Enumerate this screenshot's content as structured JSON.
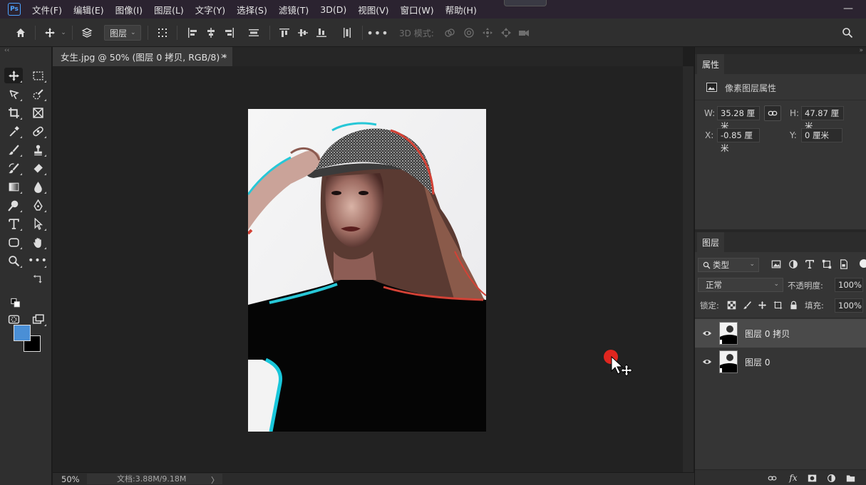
{
  "menubar": {
    "logo": "Ps",
    "items": [
      "文件(F)",
      "编辑(E)",
      "图像(I)",
      "图层(L)",
      "文字(Y)",
      "选择(S)",
      "滤镜(T)",
      "3D(D)",
      "视图(V)",
      "窗口(W)",
      "帮助(H)"
    ],
    "minimize": "—"
  },
  "options": {
    "layer_select": "图层",
    "mode_3d_label": "3D 模式:"
  },
  "toolbar": {
    "collapse": "‹‹",
    "foreground_color": "#4a8fd6",
    "background_color": "#000000"
  },
  "document": {
    "tab_title": "女生.jpg @ 50% (图层 0 拷贝, RGB/8) *",
    "close": "×"
  },
  "status": {
    "zoom": "50%",
    "doc_info": "文档:3.88M/9.18M",
    "arrow": "〉"
  },
  "properties": {
    "tab": "属性",
    "section_label": "像素图层属性",
    "w_label": "W:",
    "w_value": "35.28 厘米",
    "h_label": "H:",
    "h_value": "47.87 厘米",
    "x_label": "X:",
    "x_value": "-0.85 厘米",
    "y_label": "Y:",
    "y_value": "0 厘米"
  },
  "layers": {
    "tab": "图层",
    "kind_filter": "类型",
    "blend_mode": "正常",
    "opacity_label": "不透明度:",
    "opacity_value": "100%",
    "lock_label": "锁定:",
    "fill_label": "填充:",
    "fill_value": "100%",
    "items": [
      {
        "name": "图层 0 拷贝",
        "selected": true
      },
      {
        "name": "图层 0",
        "selected": false
      }
    ],
    "fx_label": "fx"
  }
}
